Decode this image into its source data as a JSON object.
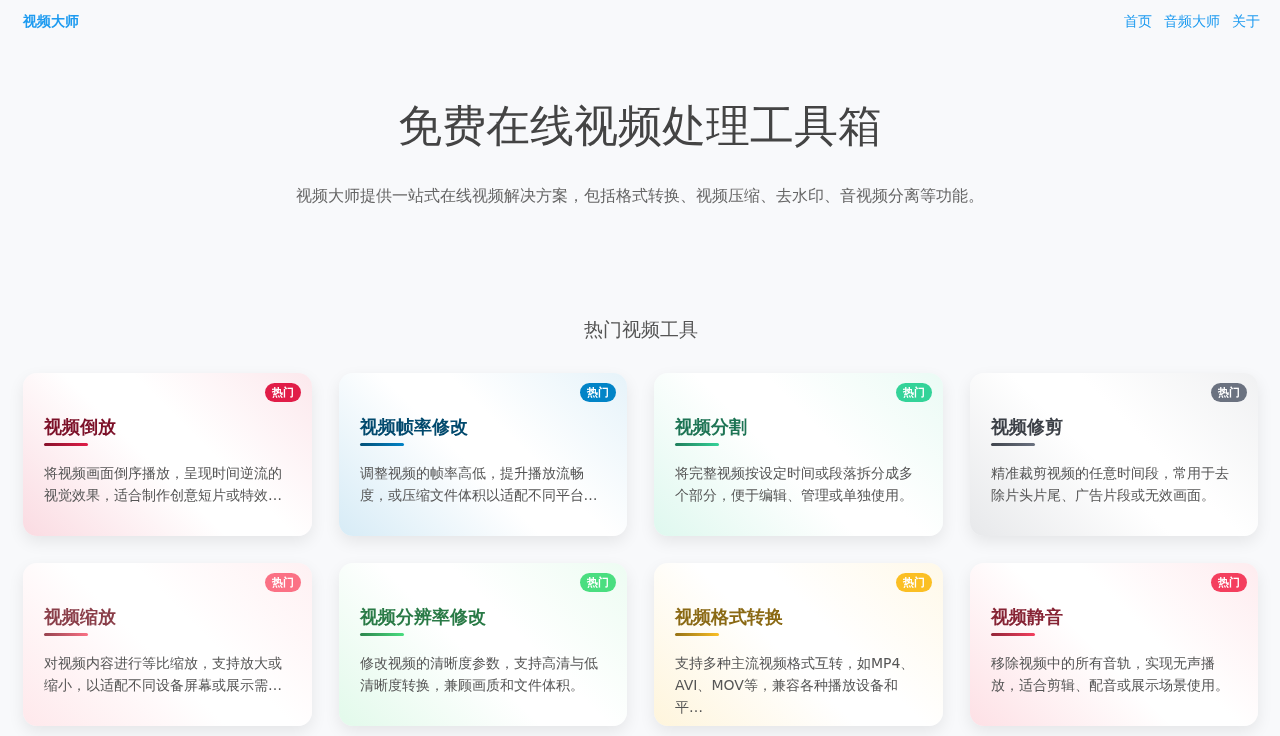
{
  "nav": {
    "brand": "视频大师",
    "links": [
      "首页",
      "音频大师",
      "关于"
    ]
  },
  "hero": {
    "title": "免费在线视频处理工具箱",
    "subtitle": "视频大师提供一站式在线视频解决方案，包括格式转换、视频压缩、去水印、音视频分离等功能。"
  },
  "section": {
    "title": "热门视频工具"
  },
  "cards": [
    {
      "title": "视频倒放",
      "description": "将视频画面倒序播放，呈现时间逆流的视觉效果，适合制作创意短片或特效…",
      "badge": "热门",
      "color": "#e11d48"
    },
    {
      "title": "视频帧率修改",
      "description": "调整视频的帧率高低，提升播放流畅度，或压缩文件体积以适配不同平台…",
      "badge": "热门",
      "color": "#0284c7"
    },
    {
      "title": "视频分割",
      "description": "将完整视频按设定时间或段落拆分成多个部分，便于编辑、管理或单独使用。",
      "badge": "热门",
      "color": "#34d399"
    },
    {
      "title": "视频修剪",
      "description": "精准裁剪视频的任意时间段，常用于去除片头片尾、广告片段或无效画面。",
      "badge": "热门",
      "color": "#6b7280"
    },
    {
      "title": "视频缩放",
      "description": "对视频内容进行等比缩放，支持放大或缩小，以适配不同设备屏幕或展示需…",
      "badge": "热门",
      "color": "#fb7185"
    },
    {
      "title": "视频分辨率修改",
      "description": "修改视频的清晰度参数，支持高清与低清晰度转换，兼顾画质和文件体积。",
      "badge": "热门",
      "color": "#4ade80"
    },
    {
      "title": "视频格式转换",
      "description": "支持多种主流视频格式互转，如MP4、AVI、MOV等，兼容各种播放设备和平…",
      "badge": "热门",
      "color": "#fbbf24"
    },
    {
      "title": "视频静音",
      "description": "移除视频中的所有音轨，实现无声播放，适合剪辑、配音或展示场景使用。",
      "badge": "热门",
      "color": "#f43f5e"
    }
  ]
}
